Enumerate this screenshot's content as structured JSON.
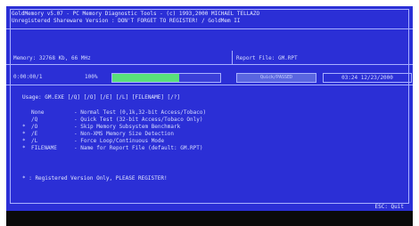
{
  "header": {
    "line1": "GoldMemory v5.07 - PC Memory Diagnostic Tools - (c) 1993,2000 MICHAEL TELLAZO",
    "line2": "Unregistered Shareware Version : DON'T FORGET TO REGISTER!   /   GoldMem II"
  },
  "info_row": {
    "memory_label": "Memory: 32768 Kb, 66 MHz",
    "report_label": "Report File: GM.RPT"
  },
  "status_row": {
    "address": "0:00:00/1",
    "percent": "100%",
    "progress_fraction": 0.62,
    "status_text": "Quick/PASSED",
    "datetime": "03:24 12/23/2000"
  },
  "usage": "Usage: GM.EXE [/Q] [/O] [/E] [/L] [FILENAME] [/?]",
  "options": [
    {
      "mark": "",
      "switch": "None",
      "desc": "- Normal Test (0,1k,32-bit Access/Tobaco)"
    },
    {
      "mark": "",
      "switch": "/Q",
      "desc": "- Quick Test (32-bit Access/Tobaco Only)"
    },
    {
      "mark": "*",
      "switch": "/O",
      "desc": "- Skip Memory Subsystem Benchmark"
    },
    {
      "mark": "*",
      "switch": "/E",
      "desc": "- Non-XMS Memory Size Detection"
    },
    {
      "mark": "*",
      "switch": "/L",
      "desc": "- Force Loop/Continuous Mode"
    },
    {
      "mark": "*",
      "switch": "FILENAME",
      "desc": "- Name for Report File (default: GM.RPT)"
    }
  ],
  "footer_note": "* : Registered Version Only, PLEASE REGISTER!",
  "bottom_bar": {
    "text": "ESC: Quit"
  },
  "colors": {
    "background": "#2b2fd6",
    "text": "#d7ddff",
    "progress_fill": "#59e07a"
  }
}
